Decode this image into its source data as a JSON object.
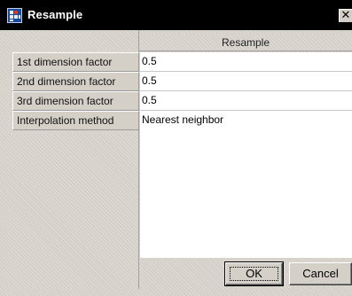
{
  "window": {
    "title": "Resample",
    "close_glyph": "✕",
    "icon": "app-grid-icon"
  },
  "table": {
    "header": "Resample",
    "rows": [
      {
        "label": "1st dimension factor",
        "value": "0.5"
      },
      {
        "label": "2nd dimension factor",
        "value": "0.5"
      },
      {
        "label": "3rd dimension factor",
        "value": "0.5"
      },
      {
        "label": "Interpolation method",
        "value": "Nearest neighbor"
      }
    ]
  },
  "buttons": {
    "ok": "OK",
    "cancel": "Cancel"
  },
  "colors": {
    "titlebar": "#000000",
    "face": "#d4d0c8",
    "field": "#ffffff",
    "icon_blue": "#1a4a9c"
  }
}
